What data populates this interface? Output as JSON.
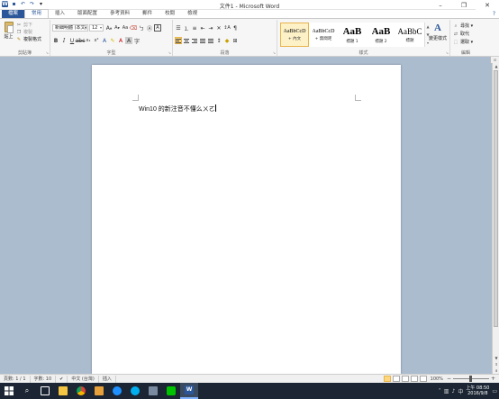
{
  "window": {
    "title": "文件1 - Microsoft Word",
    "minimize": "–",
    "restore": "❐",
    "close": "✕",
    "qat_save": "▪",
    "qat_undo": "↶",
    "qat_redo": "↷",
    "qat_more": "▾",
    "app_badge": "W"
  },
  "tabs": [
    "檔案",
    "常用",
    "插入",
    "版面配置",
    "參考資料",
    "郵件",
    "校閱",
    "檢視"
  ],
  "ribbon": {
    "clipboard": {
      "label": "剪貼簿",
      "paste": "貼上",
      "cut": "剪下",
      "copy": "複製",
      "format_painter": "複製格式"
    },
    "font": {
      "label": "字型",
      "font_name": "新細明體 (本文)",
      "font_size": "12"
    },
    "paragraph": {
      "label": "段落"
    },
    "styles": {
      "label": "樣式",
      "items": [
        {
          "sample": "AaBbCcD",
          "name": "+ 內文"
        },
        {
          "sample": "AaBbCcD",
          "name": "+ 無間距"
        },
        {
          "sample": "AaB",
          "name": "標題 1"
        },
        {
          "sample": "AaB",
          "name": "標題 2"
        },
        {
          "sample": "AaBbC",
          "name": "標題"
        }
      ],
      "change_styles": "變更樣式"
    },
    "editing": {
      "label": "編輯",
      "find": "尋找 ▾",
      "replace": "取代",
      "select": "選取 ▾"
    }
  },
  "document": {
    "text": "Win10 的新注音不懂么ㄨㄛ"
  },
  "statusbar": {
    "page": "頁數: 1 / 1",
    "words": "字數: 10",
    "language": "中文 (台灣)",
    "mode": "插入",
    "zoom": "100%"
  },
  "taskbar": {
    "clock_time": "上午 08:50",
    "clock_date": "2016/9/8"
  },
  "colors": {
    "file_tab": "#2b579a",
    "doc_background": "#abbccf",
    "taskbar": "#1b2533",
    "highlight": "#fcd77f"
  }
}
